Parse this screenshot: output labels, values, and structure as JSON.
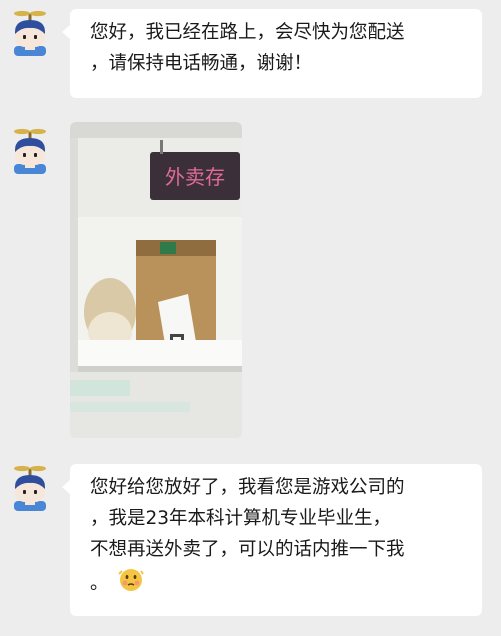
{
  "messages": [
    {
      "type": "text",
      "lines": [
        "您好，我已经在路上，会尽快为您配送",
        "，请保持电话畅通，谢谢！"
      ]
    },
    {
      "type": "image",
      "sign_text": "外卖存"
    },
    {
      "type": "text",
      "lines": [
        "您好给您放好了，我看您是游戏公司的",
        "，我是23年本科计算机专业毕业生，",
        "不想再送外卖了，可以的话内推一下我",
        "。"
      ],
      "emoji": "shy-face-emoji"
    }
  ],
  "colors": {
    "background": "#ededed",
    "bubble": "#ffffff",
    "avatar_hair": "#2f4f9e",
    "avatar_shirt": "#4a86d6",
    "propeller": "#d6b24a"
  }
}
